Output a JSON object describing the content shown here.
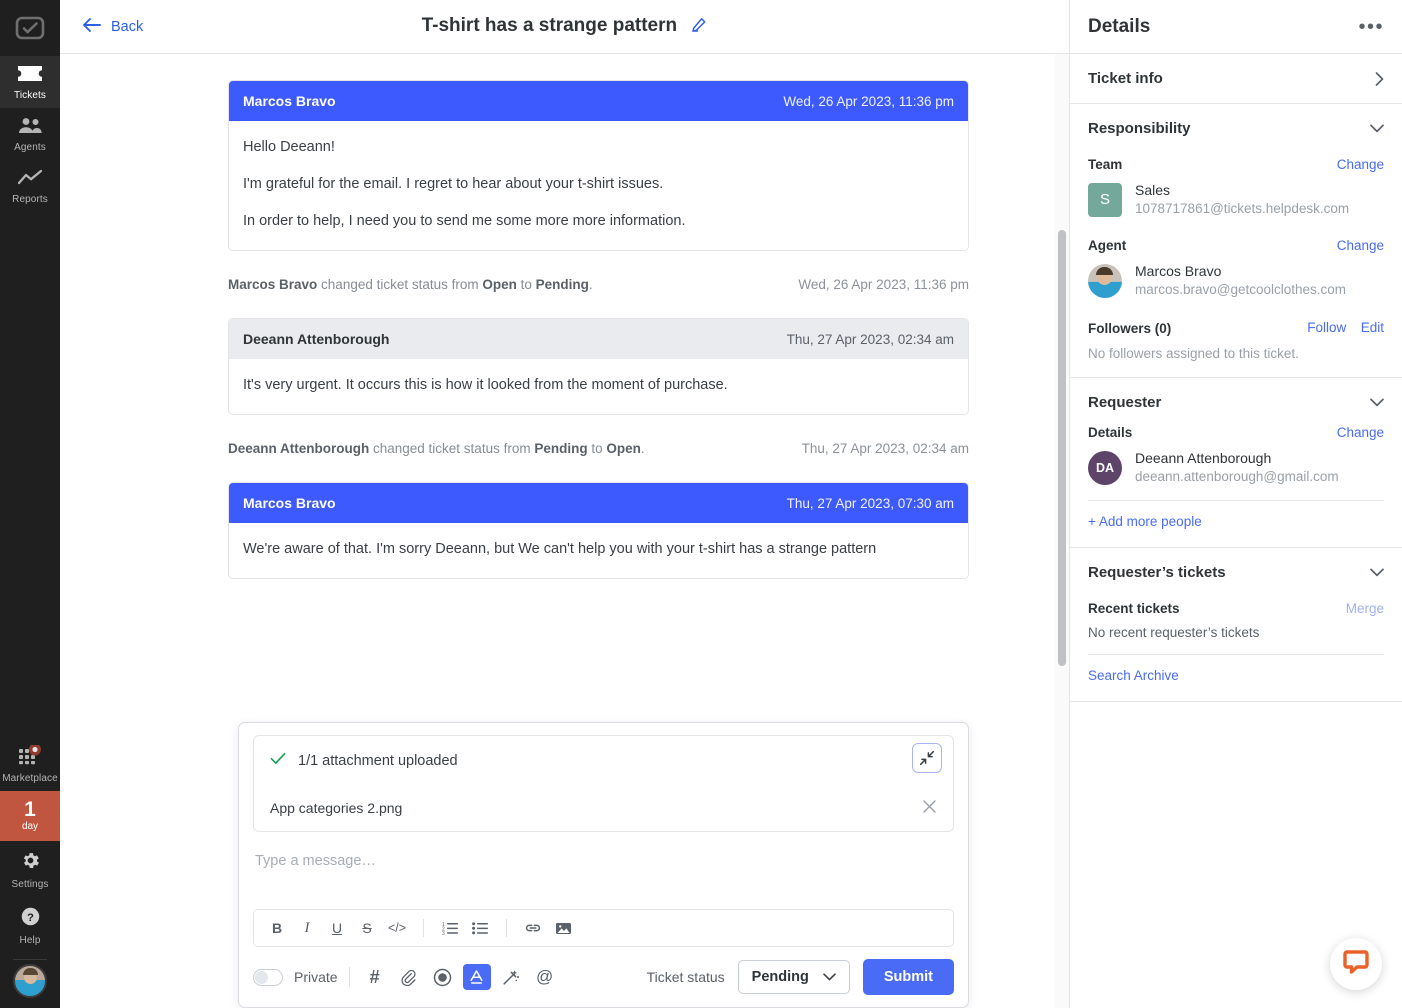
{
  "rail": {
    "logo": "helpdesk-logo",
    "items": [
      {
        "label": "Tickets",
        "icon": "ticket-icon",
        "active": true
      },
      {
        "label": "Agents",
        "icon": "agents-icon",
        "active": false
      },
      {
        "label": "Reports",
        "icon": "reports-icon",
        "active": false
      }
    ],
    "marketplace": {
      "label": "Marketplace",
      "icon": "marketplace-icon"
    },
    "trial": {
      "count": "1",
      "unit": "day"
    },
    "settings": {
      "label": "Settings",
      "icon": "gear-icon"
    },
    "help": {
      "label": "Help",
      "icon": "question-icon"
    }
  },
  "topbar": {
    "back_label": "Back",
    "ticket_title": "T-shirt has a strange pattern",
    "edit_icon": "pencil-icon"
  },
  "thread": {
    "entries": [
      {
        "kind": "message",
        "variant": "agent",
        "author": "Marcos Bravo",
        "timestamp": "Wed, 26 Apr 2023, 11:36 pm",
        "paragraphs": [
          "Hello Deeann!",
          "I'm grateful for the email. I regret to hear about your t-shirt issues.",
          "In order to help, I need you to send me some more more information."
        ]
      },
      {
        "kind": "event",
        "actor": "Marcos Bravo",
        "text_mid": " changed ticket status from ",
        "from_status": "Open",
        "text_to": " to ",
        "to_status": "Pending",
        "text_end": ".",
        "timestamp": "Wed, 26 Apr 2023, 11:36 pm"
      },
      {
        "kind": "message",
        "variant": "customer",
        "author": "Deeann Attenborough",
        "timestamp": "Thu, 27 Apr 2023, 02:34 am",
        "paragraphs": [
          "It's very urgent. It occurs this is how it looked from the moment of purchase."
        ]
      },
      {
        "kind": "event",
        "actor": "Deeann Attenborough",
        "text_mid": " changed ticket status from ",
        "from_status": "Pending",
        "text_to": " to ",
        "to_status": "Open",
        "text_end": ".",
        "timestamp": "Thu, 27 Apr 2023, 02:34 am"
      },
      {
        "kind": "message",
        "variant": "agent",
        "author": "Marcos Bravo",
        "timestamp": "Thu, 27 Apr 2023, 07:30 am",
        "paragraphs": [
          "We're aware of that. I'm sorry Deeann, but We can't help you with your t-shirt has a strange pattern"
        ]
      }
    ]
  },
  "composer": {
    "attachment_status": "1/1 attachment uploaded",
    "attachment_name": "App categories 2.png",
    "collapse_icon": "collapse-arrows-icon",
    "remove_icon": "close-icon",
    "check_icon": "check-icon",
    "message_placeholder": "Type a message…",
    "format_tools": [
      {
        "name": "bold",
        "glyph": "B"
      },
      {
        "name": "italic",
        "glyph": "I"
      },
      {
        "name": "underline",
        "glyph": "U"
      },
      {
        "name": "strikethrough",
        "glyph": "S"
      },
      {
        "name": "code",
        "glyph": "</>"
      },
      {
        "name": "ordered-list",
        "glyph": ""
      },
      {
        "name": "bullet-list",
        "glyph": ""
      },
      {
        "name": "link",
        "glyph": ""
      },
      {
        "name": "image",
        "glyph": ""
      }
    ],
    "private_label": "Private",
    "private_on": false,
    "actions": [
      {
        "name": "canned-response",
        "glyph": "#",
        "active": false
      },
      {
        "name": "attachment",
        "glyph": "",
        "active": false
      },
      {
        "name": "record",
        "glyph": "",
        "active": false
      },
      {
        "name": "text-format",
        "glyph": "A",
        "active": true
      },
      {
        "name": "ai-assist",
        "glyph": "",
        "active": false
      },
      {
        "name": "mention",
        "glyph": "@",
        "active": false
      }
    ],
    "status_label": "Ticket status",
    "status_value": "Pending",
    "submit_label": "Submit"
  },
  "details": {
    "title": "Details",
    "more_icon": "ellipsis-icon",
    "ticket_info": {
      "label": "Ticket info",
      "chevron": "chevron-right-icon"
    },
    "responsibility": {
      "label": "Responsibility",
      "chevron": "chevron-down-icon",
      "team_label": "Team",
      "team_change": "Change",
      "team_initial": "S",
      "team_name": "Sales",
      "team_email": "1078717861@tickets.helpdesk.com",
      "agent_label": "Agent",
      "agent_change": "Change",
      "agent_name": "Marcos Bravo",
      "agent_email": "marcos.bravo@getcoolclothes.com",
      "followers_label": "Followers (0)",
      "follow_link": "Follow",
      "edit_link": "Edit",
      "followers_empty": "No followers assigned to this ticket."
    },
    "requester": {
      "label": "Requester",
      "chevron": "chevron-down-icon",
      "details_label": "Details",
      "change_link": "Change",
      "initials": "DA",
      "name": "Deeann Attenborough",
      "email": "deeann.attenborough@gmail.com",
      "add_people": "+ Add more people"
    },
    "requester_tickets": {
      "label": "Requester’s tickets",
      "chevron": "chevron-down-icon",
      "recent_label": "Recent tickets",
      "merge_link": "Merge",
      "empty": "No recent requester’s tickets",
      "search_archive": "Search Archive"
    }
  },
  "chat_widget": {
    "icon": "chat-bubble-icon",
    "color": "#e8632a"
  },
  "colors": {
    "agent_blue": "#3d5afe",
    "accent_blue": "#4a6bf5",
    "rail_bg": "#1f1f1f",
    "trial_bg": "#c0563f",
    "team_avatar": "#74a89a",
    "requester_avatar": "#5d4468"
  }
}
